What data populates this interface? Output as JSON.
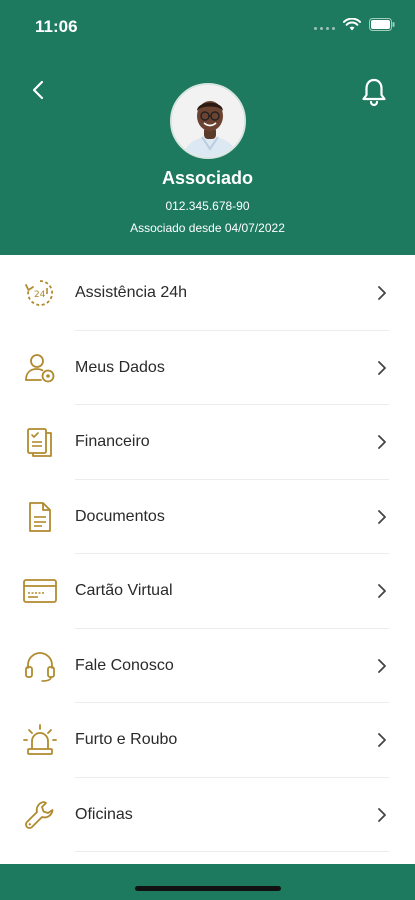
{
  "status_bar": {
    "time": "11:06"
  },
  "profile": {
    "name": "Associado",
    "id": "012.345.678-90",
    "since": "Associado desde 04/07/2022"
  },
  "menu": {
    "items": [
      {
        "label": "Assistência 24h",
        "icon": "assistance-24h-icon"
      },
      {
        "label": "Meus Dados",
        "icon": "user-settings-icon"
      },
      {
        "label": "Financeiro",
        "icon": "finance-documents-icon"
      },
      {
        "label": "Documentos",
        "icon": "document-icon"
      },
      {
        "label": "Cartão Virtual",
        "icon": "card-icon"
      },
      {
        "label": "Fale Conosco",
        "icon": "headset-icon"
      },
      {
        "label": "Furto e Roubo",
        "icon": "alarm-siren-icon"
      },
      {
        "label": "Oficinas",
        "icon": "wrench-icon"
      }
    ]
  },
  "colors": {
    "header": "#1e7a5e",
    "icon_gold": "#b08a2e",
    "text": "#2a2a2a"
  }
}
